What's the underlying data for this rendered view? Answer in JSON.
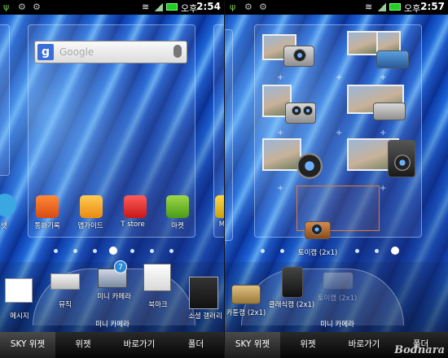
{
  "left": {
    "status": {
      "ampm": "오후",
      "time": "2:54"
    },
    "search": {
      "placeholder": "Google",
      "g": "g"
    },
    "apps": [
      {
        "label": "넷"
      },
      {
        "label": "통화기록"
      },
      {
        "label": "앱가이드"
      },
      {
        "label": "T store"
      },
      {
        "label": "마켓"
      },
      {
        "label": "Me"
      }
    ],
    "tray": {
      "badge": "7",
      "widget_title": "미니 카메라",
      "items": [
        {
          "label": "메시지"
        },
        {
          "label": "뮤직"
        },
        {
          "label": "미니 카메라"
        },
        {
          "label": "북마크"
        },
        {
          "label": "소셜 갤러리"
        }
      ]
    },
    "tabs": [
      {
        "label": "SKY 위젯",
        "active": true
      },
      {
        "label": "위젯",
        "active": false
      },
      {
        "label": "바로가기",
        "active": false
      },
      {
        "label": "폴더",
        "active": false
      }
    ]
  },
  "right": {
    "status": {
      "ampm": "오후",
      "time": "2:57"
    },
    "drop_label": "토이캠 (2x1)",
    "tray": {
      "widget_title": "미니 카메라",
      "items": [
        {
          "label": "카툰캠 (2x1)"
        },
        {
          "label": "클래식캠 (2x1)"
        },
        {
          "label": "토이캠 (2x1)"
        }
      ]
    },
    "tabs": [
      {
        "label": "SKY 위젯",
        "active": true
      },
      {
        "label": "위젯",
        "active": false
      },
      {
        "label": "바로가기",
        "active": false
      },
      {
        "label": "폴더",
        "active": false
      }
    ]
  },
  "watermark": "Bodnara",
  "colors": {
    "wallpaper": "#1d64d6",
    "selection": "#e07a30"
  }
}
